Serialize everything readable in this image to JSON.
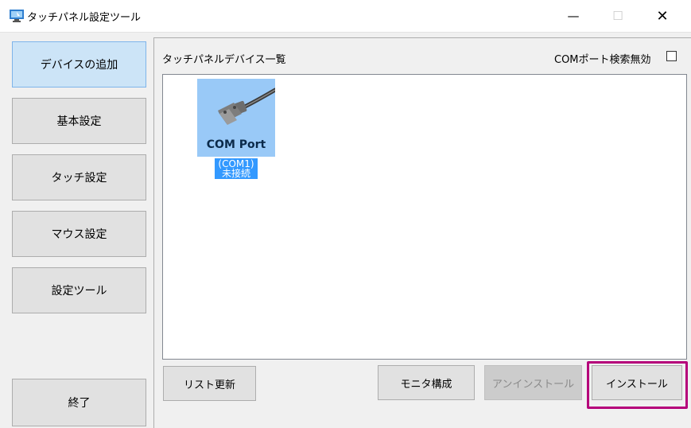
{
  "window": {
    "title": "タッチパネル設定ツール",
    "minimize_glyph": "—",
    "maximize_glyph": "☐",
    "close_glyph": "✕"
  },
  "sidebar": {
    "items": [
      {
        "label": "デバイスの追加"
      },
      {
        "label": "基本設定"
      },
      {
        "label": "タッチ設定"
      },
      {
        "label": "マウス設定"
      },
      {
        "label": "設定ツール"
      }
    ],
    "exit_label": "終了"
  },
  "main": {
    "list_title": "タッチパネルデバイス一覧",
    "com_disable_label": "COMポート検索無効",
    "devices": [
      {
        "name": "COM Port",
        "port": "(COM1)",
        "status": "未接続"
      }
    ],
    "buttons": {
      "refresh": "リスト更新",
      "monitor": "モニタ構成",
      "uninstall": "アンインストール",
      "install": "インストール"
    }
  },
  "colors": {
    "selected_sidebar": "#cce4f7",
    "selection_blue": "#3399ff",
    "highlight": "#b5007a"
  }
}
